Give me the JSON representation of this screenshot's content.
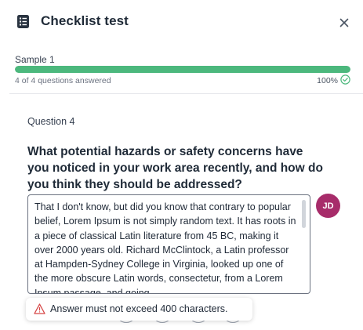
{
  "header": {
    "title": "Checklist test",
    "icon": "checklist-icon",
    "close_icon": "close-icon"
  },
  "progress": {
    "sample_label": "Sample 1",
    "answered_text": "4 of 4 questions answered",
    "percent_text": "100%",
    "fraction": 1.0,
    "color": "#4cb87d"
  },
  "question": {
    "label": "Question 4",
    "text": "What potential hazards or safety concerns have you noticed in your work area recently, and how do you think they should be addressed?",
    "answer": "That I don't know, but did you know that contrary to popular belief, Lorem Ipsum is not simply random text. It has roots in a piece of classical Latin literature from 45 BC, making it over 2000 years old. Richard McClintock, a Latin professor at Hampden-Sydney College in Virginia, looked up one of the more obscure Latin words, consectetur, from a Lorem Ipsum passage, and going"
  },
  "avatar": {
    "initials": "JD",
    "color": "#a72c6a"
  },
  "error": {
    "icon": "warning-icon",
    "message": "Answer must not exceed 400 characters.",
    "color": "#d64545"
  }
}
